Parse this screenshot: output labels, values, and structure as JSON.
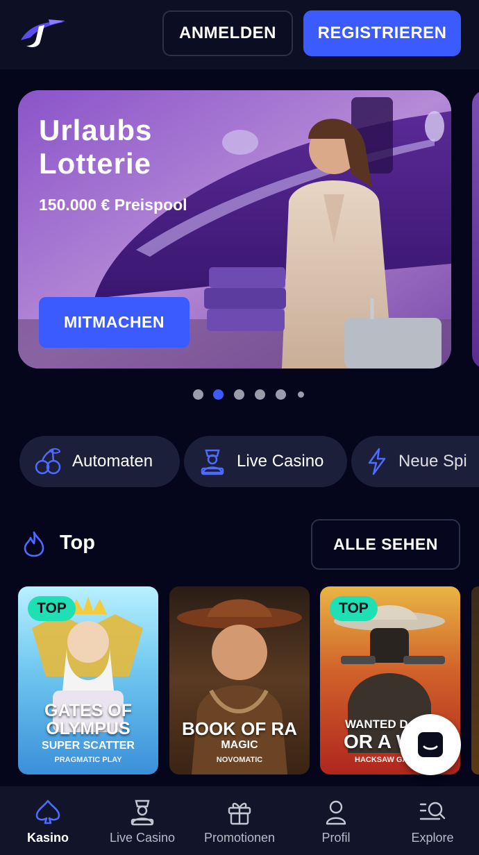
{
  "header": {
    "login_label": "ANMELDEN",
    "register_label": "REGISTRIEREN"
  },
  "banner": {
    "title_line1": "Urlaubs",
    "title_line2": "Lotterie",
    "subtitle": "150.000 € Preispool",
    "cta_label": "MITMACHEN",
    "pagination": {
      "total": 6,
      "active_index": 1
    }
  },
  "categories": [
    {
      "label": "Automaten",
      "icon": "cherries-icon"
    },
    {
      "label": "Live Casino",
      "icon": "dealer-icon"
    },
    {
      "label": "Neue Spi",
      "icon": "lightning-icon"
    }
  ],
  "top_section": {
    "title": "Top",
    "icon": "flame-icon",
    "see_all_label": "ALLE SEHEN",
    "games": [
      {
        "badge": "TOP",
        "name_line1": "GATES OF",
        "name_line2": "OLYMPUS",
        "subtitle": "SUPER SCATTER",
        "provider": "PRAGMATIC PLAY"
      },
      {
        "badge": "",
        "name_line1": "BOOK OF RA",
        "name_line2": "",
        "subtitle": "MAGIC",
        "provider": "NOVOMATIC"
      },
      {
        "badge": "TOP",
        "name_line1": "WANTED D",
        "name_line2": "OR A W",
        "subtitle": "",
        "provider": "HACKSAW GA"
      }
    ]
  },
  "bottom_nav": [
    {
      "label": "Kasino",
      "icon": "spade-icon",
      "active": true
    },
    {
      "label": "Live Casino",
      "icon": "dealer-icon",
      "active": false
    },
    {
      "label": "Promotionen",
      "icon": "gift-icon",
      "active": false
    },
    {
      "label": "Profil",
      "icon": "user-icon",
      "active": false
    },
    {
      "label": "Explore",
      "icon": "search-explore-icon",
      "active": false
    }
  ],
  "colors": {
    "accent": "#3b5bff",
    "background": "#05051c",
    "badge": "#1ee0b4",
    "chip": "#1b1f3a"
  }
}
